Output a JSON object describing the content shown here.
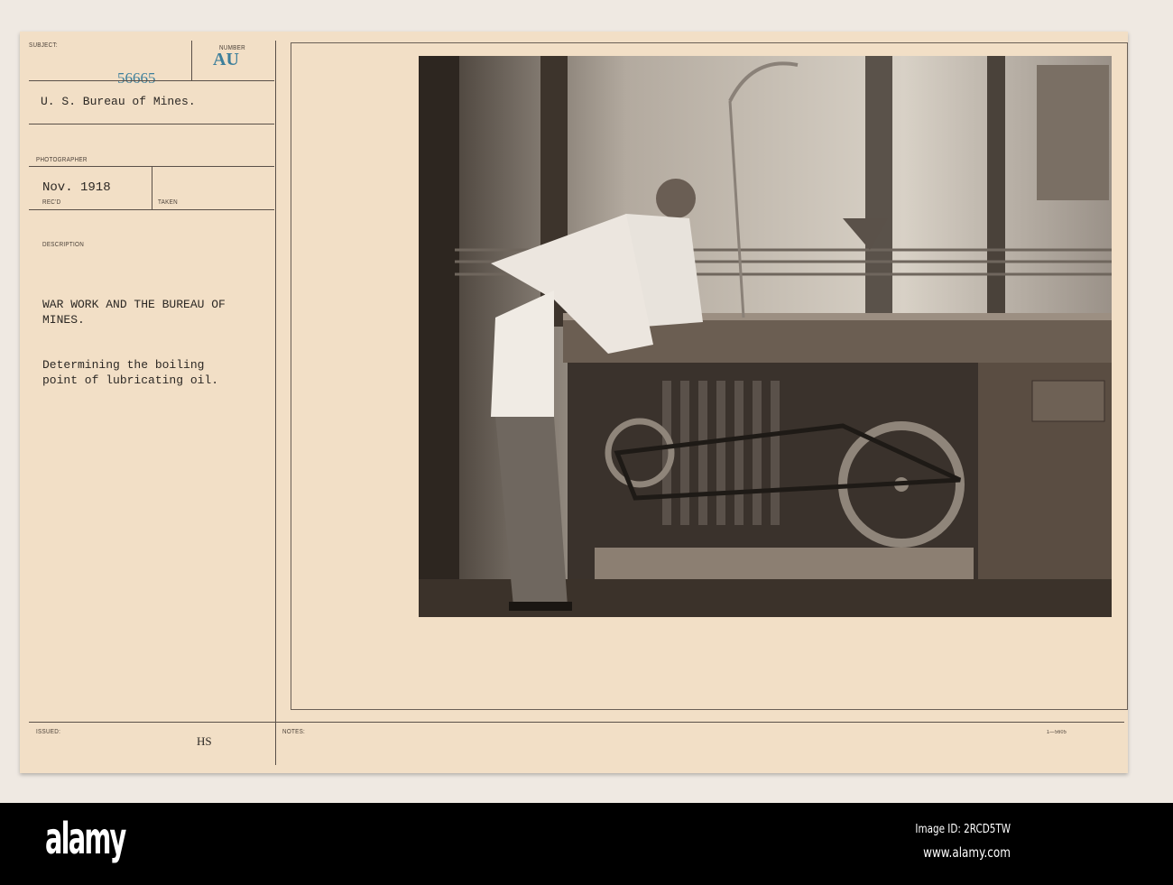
{
  "card": {
    "subject_label": "SUBJECT:",
    "number_label": "NUMBER",
    "number_stamp": "AU",
    "serial_stamp": "56665",
    "subject_value": "U. S. Bureau of Mines.",
    "photographer_label": "PHOTOGRAPHER",
    "recd_value": "Nov. 1918",
    "recd_label": "REC'D",
    "taken_label": "TAKEN",
    "description_label": "DESCRIPTION",
    "description_title_1": "WAR WORK AND THE BUREAU OF",
    "description_title_2": "MINES.",
    "description_text_1": "Determining the boiling",
    "description_text_2": "point of lubricating oil.",
    "issued_label": "ISSUED:",
    "issued_value": "HS",
    "notes_label": "NOTES:",
    "form_number": "1—5605"
  },
  "watermark": {
    "brand": "alamy",
    "image_id": "Image ID: 2RCD5TW",
    "url": "www.alamy.com"
  },
  "colors": {
    "paper": "#f2dfc6",
    "stamp": "#3d7f9b",
    "ink": "#2c2824"
  }
}
